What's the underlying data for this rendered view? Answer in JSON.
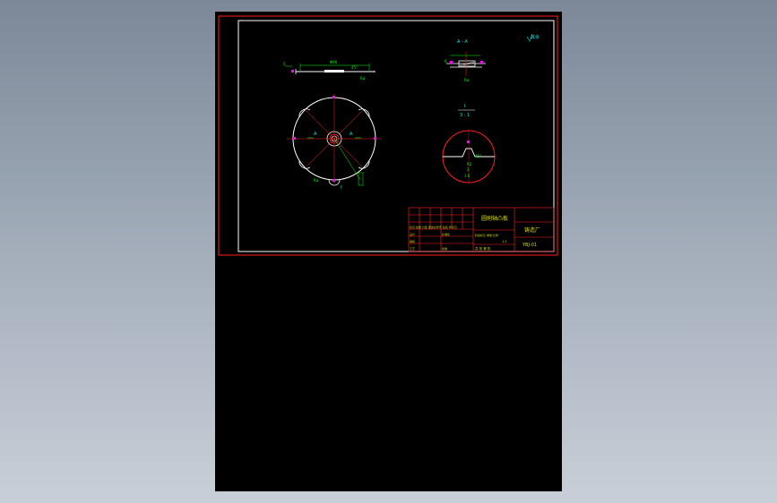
{
  "drawing": {
    "section_label": "A - A",
    "detail_label": "I",
    "detail_scale": "3 : 1",
    "corner_note": "其余",
    "section_mark_left": "A",
    "section_mark_right": "A",
    "detail_callout": "I",
    "roughness_top": "1.6",
    "dim_top": "Φ66",
    "dim_side_left": "5",
    "dim_angle": "45°",
    "dim_ra": "Ra",
    "dim_small": "6",
    "dim_detail_a": "45°",
    "dim_detail_b": "R2",
    "dim_detail_c": "2",
    "dim_detail_d": "1.6"
  },
  "title_block": {
    "part_name": "圆刷轴凸板",
    "company": "铸造厂",
    "drawing_no": "YBJ-01",
    "row_label_1": "标记 处数 分区 更改文件号 签名 年月日",
    "row_label_2": "设计",
    "row_label_3": "审核",
    "row_label_4": "工艺",
    "row_label_5": "标准化",
    "row_label_6": "批准",
    "stage_label": "阶段标记 重量 比例",
    "sheet_label": "共 张 第 张",
    "scale": "1:1"
  },
  "colors": {
    "sheet": "#000000",
    "frame": "#ff2020",
    "border": "#ffffff",
    "dimension": "#00ff00",
    "text": "#00e0e0",
    "accent": "#ff00ff",
    "title_text": "#d8d800"
  }
}
